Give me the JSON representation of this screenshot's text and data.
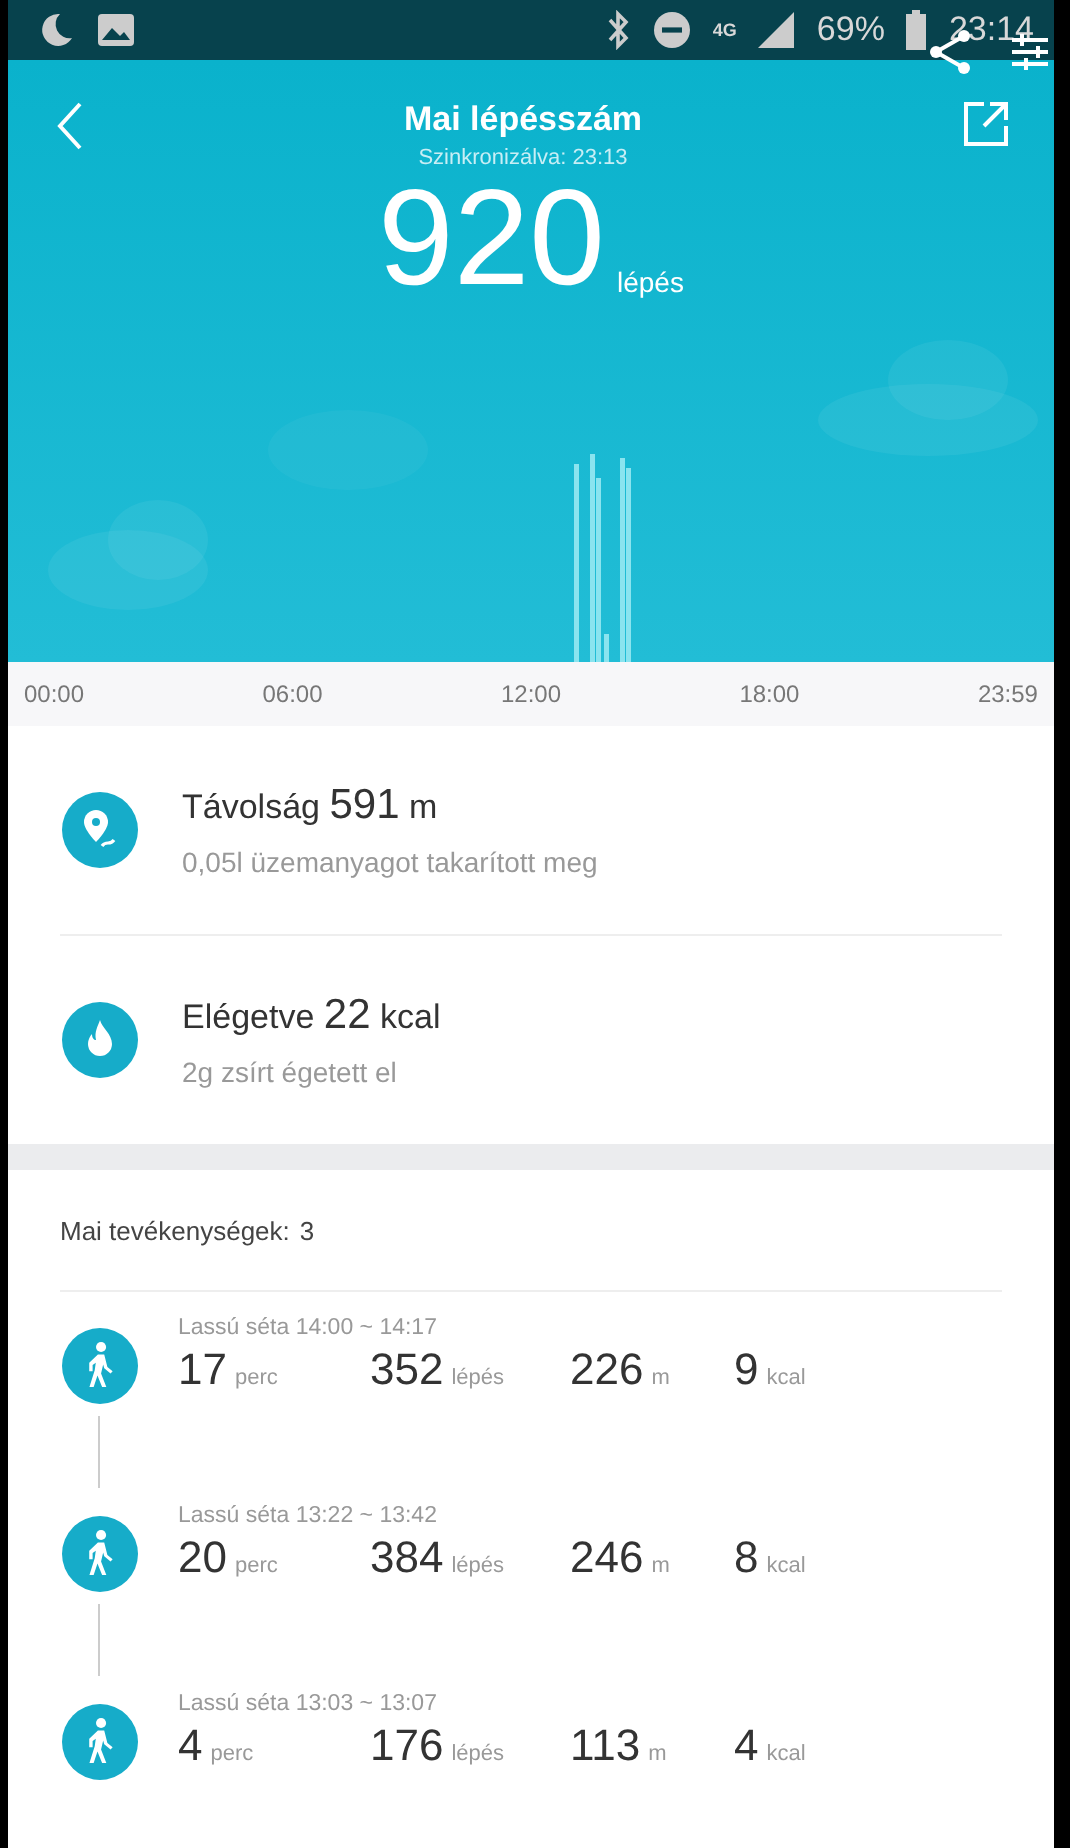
{
  "status_bar": {
    "network": "4G",
    "battery": "69%",
    "time": "23:14"
  },
  "header": {
    "title": "Mai lépésszám",
    "subtitle": "Szinkronizálva: 23:13",
    "steps": "920",
    "steps_unit": "lépés"
  },
  "time_axis": [
    "00:00",
    "06:00",
    "12:00",
    "18:00",
    "23:59"
  ],
  "stats": [
    {
      "kind": "distance",
      "label": "Távolság",
      "value": "591",
      "unit": "m",
      "note": "0,05l üzemanyagot takarított meg"
    },
    {
      "kind": "calories",
      "label": "Elégetve",
      "value": "22",
      "unit": "kcal",
      "note": "2g zsírt égetett el"
    }
  ],
  "activities": {
    "heading": "Mai tevékenységek:",
    "count": "3",
    "items": [
      {
        "title": "Lassú séta 14:00 ~ 14:17",
        "metrics": [
          {
            "value": "17",
            "unit": "perc"
          },
          {
            "value": "352",
            "unit": "lépés"
          },
          {
            "value": "226",
            "unit": "m"
          },
          {
            "value": "9",
            "unit": "kcal"
          }
        ]
      },
      {
        "title": "Lassú séta 13:22 ~ 13:42",
        "metrics": [
          {
            "value": "20",
            "unit": "perc"
          },
          {
            "value": "384",
            "unit": "lépés"
          },
          {
            "value": "246",
            "unit": "m"
          },
          {
            "value": "8",
            "unit": "kcal"
          }
        ]
      },
      {
        "title": "Lassú séta 13:03 ~ 13:07",
        "metrics": [
          {
            "value": "4",
            "unit": "perc"
          },
          {
            "value": "176",
            "unit": "lépés"
          },
          {
            "value": "113",
            "unit": "m"
          },
          {
            "value": "4",
            "unit": "kcal"
          }
        ]
      }
    ]
  }
}
